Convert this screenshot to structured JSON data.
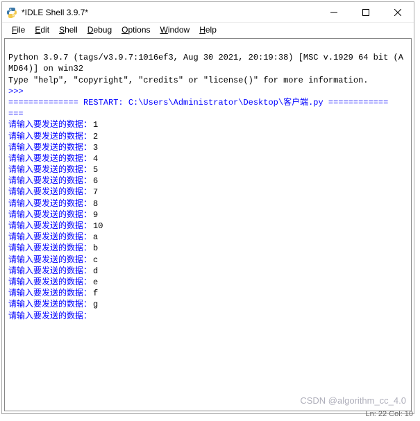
{
  "window": {
    "title": "*IDLE Shell 3.9.7*"
  },
  "menu": {
    "file": "File",
    "edit": "Edit",
    "shell": "Shell",
    "debug": "Debug",
    "options": "Options",
    "window": "Window",
    "help": "Help"
  },
  "shell": {
    "banner_line1": "Python 3.9.7 (tags/v3.9.7:1016ef3, Aug 30 2021, 20:19:38) [MSC v.1929 64 bit (AMD64)] on win32",
    "banner_line2": "Type \"help\", \"copyright\", \"credits\" or \"license()\" for more information.",
    "prompt": ">>>",
    "restart_line": "============== RESTART: C:\\Users\\Administrator\\Desktop\\客户端.py ============",
    "restart_line2": "===",
    "input_prompt": "请输入要发送的数据：",
    "inputs": [
      "1",
      "2",
      "3",
      "4",
      "5",
      "6",
      "7",
      "8",
      "9",
      "10",
      "a",
      "b",
      "c",
      "d",
      "e",
      "f",
      "g",
      ""
    ]
  },
  "status": {
    "text": "Ln: 22  Col: 10"
  },
  "watermark": {
    "text": "CSDN @algorithm_cc_4.0"
  }
}
